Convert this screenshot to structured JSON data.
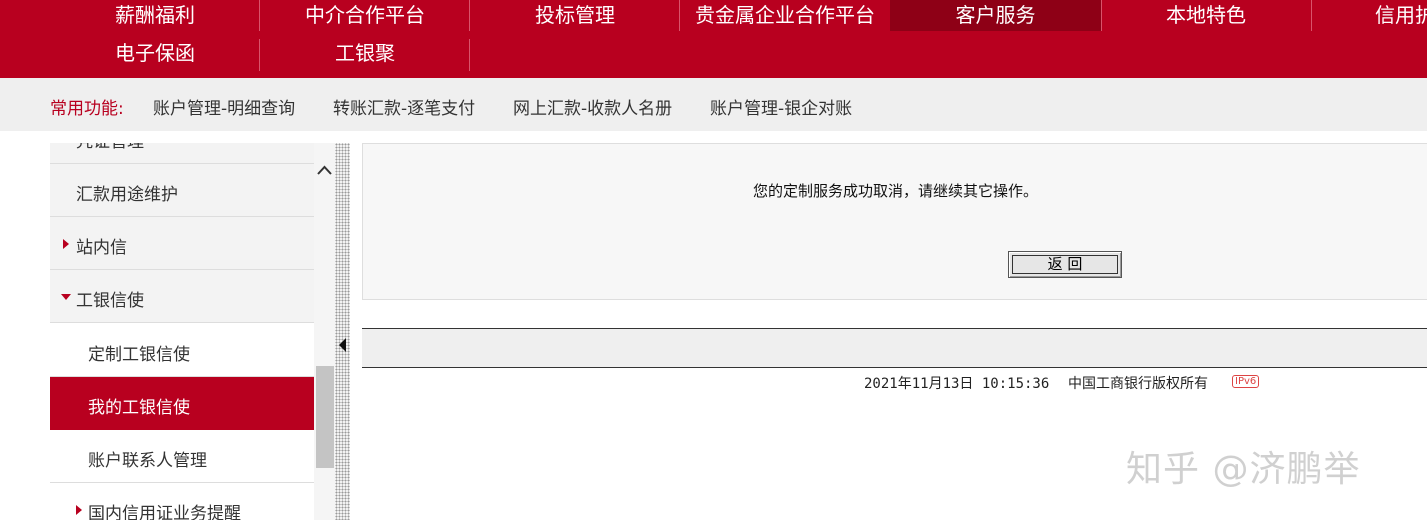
{
  "nav": {
    "items": [
      "薪酬福利",
      "中介合作平台",
      "投标管理",
      "贵金属企业合作平台",
      "客户服务",
      "本地特色",
      "信用护",
      "电子保函",
      "工银聚"
    ],
    "active": "客户服务"
  },
  "quick": {
    "label": "常用功能:",
    "links": [
      "账户管理-明细查询",
      "转账汇款-逐笔支付",
      "网上汇款-收款人名册",
      "账户管理-银企对账"
    ]
  },
  "sidebar": {
    "items": [
      {
        "label": "凭证管理"
      },
      {
        "label": "汇款用途维护"
      },
      {
        "label": "站内信"
      },
      {
        "label": "工银信使"
      },
      {
        "label": "定制工银信使"
      },
      {
        "label": "我的工银信使"
      },
      {
        "label": "账户联系人管理"
      },
      {
        "label": "国内信用证业务提醒"
      }
    ]
  },
  "content": {
    "message": "您的定制服务成功取消，请继续其它操作。",
    "back_button": "返 回"
  },
  "footer": {
    "datetime": "2021年11月13日  10:15:36",
    "copyright": "中国工商银行版权所有",
    "ipv6_badge": "IPv6"
  },
  "watermark": "知乎 @济鹏举",
  "colors": {
    "brand_red": "#b8001f",
    "active_red": "#8e0016"
  }
}
